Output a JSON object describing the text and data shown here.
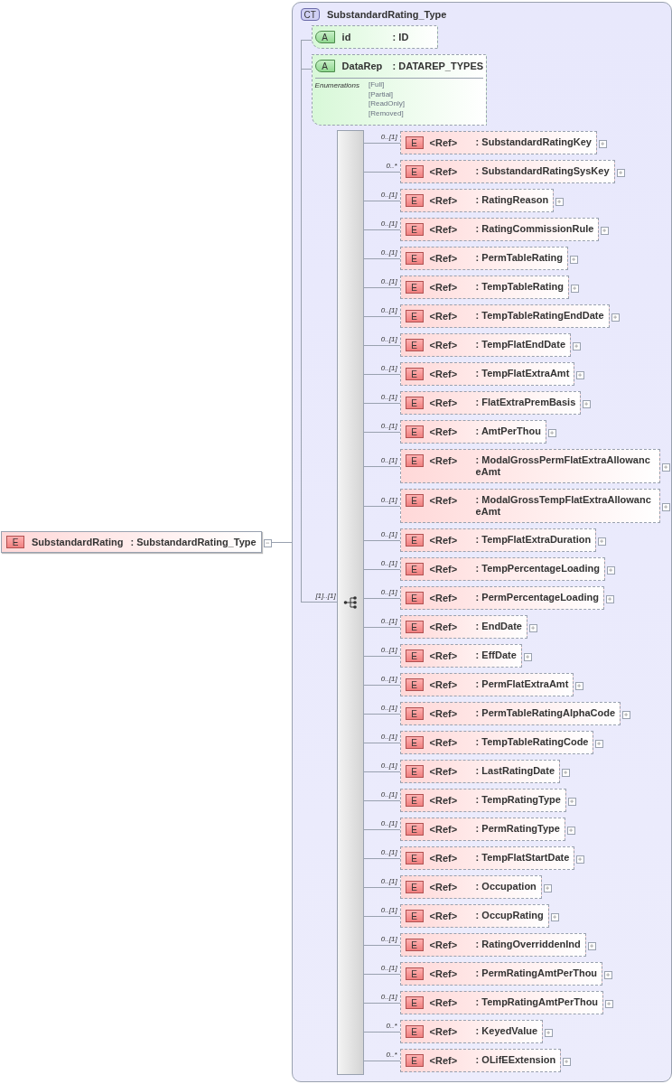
{
  "root_element": {
    "badge": "E",
    "name": "SubstandardRating",
    "type": ": SubstandardRating_Type",
    "expanded": true
  },
  "complex_type": {
    "badge": "CT",
    "name": "SubstandardRating_Type",
    "attributes": [
      {
        "badge": "A",
        "name": "id",
        "type": ": ID"
      },
      {
        "badge": "A",
        "name": "DataRep",
        "type": ": DATAREP_TYPES",
        "enumerations_label": "Enumerations",
        "enumerations": [
          "[Full]",
          "[Partial]",
          "[ReadOnly]",
          "[Removed]"
        ]
      }
    ],
    "sequence": {
      "multiplicity": "[1]..[1]",
      "elements": [
        {
          "multiplicity": "0..[1]",
          "badge": "E",
          "ref": "<Ref>",
          "name": ": SubstandardRatingKey",
          "expanded": false
        },
        {
          "multiplicity": "0..*",
          "badge": "E",
          "ref": "<Ref>",
          "name": ": SubstandardRatingSysKey",
          "expanded": false
        },
        {
          "multiplicity": "0..[1]",
          "badge": "E",
          "ref": "<Ref>",
          "name": ": RatingReason",
          "expanded": false
        },
        {
          "multiplicity": "0..[1]",
          "badge": "E",
          "ref": "<Ref>",
          "name": ": RatingCommissionRule",
          "expanded": false
        },
        {
          "multiplicity": "0..[1]",
          "badge": "E",
          "ref": "<Ref>",
          "name": ": PermTableRating",
          "expanded": false
        },
        {
          "multiplicity": "0..[1]",
          "badge": "E",
          "ref": "<Ref>",
          "name": ": TempTableRating",
          "expanded": false
        },
        {
          "multiplicity": "0..[1]",
          "badge": "E",
          "ref": "<Ref>",
          "name": ": TempTableRatingEndDate",
          "expanded": false
        },
        {
          "multiplicity": "0..[1]",
          "badge": "E",
          "ref": "<Ref>",
          "name": ": TempFlatEndDate",
          "expanded": false
        },
        {
          "multiplicity": "0..[1]",
          "badge": "E",
          "ref": "<Ref>",
          "name": ": TempFlatExtraAmt",
          "expanded": false
        },
        {
          "multiplicity": "0..[1]",
          "badge": "E",
          "ref": "<Ref>",
          "name": ": FlatExtraPremBasis",
          "expanded": false
        },
        {
          "multiplicity": "0..[1]",
          "badge": "E",
          "ref": "<Ref>",
          "name": ": AmtPerThou",
          "expanded": false
        },
        {
          "multiplicity": "0..[1]",
          "badge": "E",
          "ref": "<Ref>",
          "name": ": ModalGrossPermFlatExtraAllowanceAmt",
          "expanded": false
        },
        {
          "multiplicity": "0..[1]",
          "badge": "E",
          "ref": "<Ref>",
          "name": ": ModalGrossTempFlatExtraAllowanceAmt",
          "expanded": false
        },
        {
          "multiplicity": "0..[1]",
          "badge": "E",
          "ref": "<Ref>",
          "name": ": TempFlatExtraDuration",
          "expanded": false
        },
        {
          "multiplicity": "0..[1]",
          "badge": "E",
          "ref": "<Ref>",
          "name": ": TempPercentageLoading",
          "expanded": false
        },
        {
          "multiplicity": "0..[1]",
          "badge": "E",
          "ref": "<Ref>",
          "name": ": PermPercentageLoading",
          "expanded": false
        },
        {
          "multiplicity": "0..[1]",
          "badge": "E",
          "ref": "<Ref>",
          "name": ": EndDate",
          "expanded": false
        },
        {
          "multiplicity": "0..[1]",
          "badge": "E",
          "ref": "<Ref>",
          "name": ": EffDate",
          "expanded": false
        },
        {
          "multiplicity": "0..[1]",
          "badge": "E",
          "ref": "<Ref>",
          "name": ": PermFlatExtraAmt",
          "expanded": false
        },
        {
          "multiplicity": "0..[1]",
          "badge": "E",
          "ref": "<Ref>",
          "name": ": PermTableRatingAlphaCode",
          "expanded": false
        },
        {
          "multiplicity": "0..[1]",
          "badge": "E",
          "ref": "<Ref>",
          "name": ": TempTableRatingCode",
          "expanded": false
        },
        {
          "multiplicity": "0..[1]",
          "badge": "E",
          "ref": "<Ref>",
          "name": ": LastRatingDate",
          "expanded": false
        },
        {
          "multiplicity": "0..[1]",
          "badge": "E",
          "ref": "<Ref>",
          "name": ": TempRatingType",
          "expanded": false
        },
        {
          "multiplicity": "0..[1]",
          "badge": "E",
          "ref": "<Ref>",
          "name": ": PermRatingType",
          "expanded": false
        },
        {
          "multiplicity": "0..[1]",
          "badge": "E",
          "ref": "<Ref>",
          "name": ": TempFlatStartDate",
          "expanded": false
        },
        {
          "multiplicity": "0..[1]",
          "badge": "E",
          "ref": "<Ref>",
          "name": ": Occupation",
          "expanded": false
        },
        {
          "multiplicity": "0..[1]",
          "badge": "E",
          "ref": "<Ref>",
          "name": ": OccupRating",
          "expanded": false
        },
        {
          "multiplicity": "0..[1]",
          "badge": "E",
          "ref": "<Ref>",
          "name": ": RatingOverriddenInd",
          "expanded": false
        },
        {
          "multiplicity": "0..[1]",
          "badge": "E",
          "ref": "<Ref>",
          "name": ": PermRatingAmtPerThou",
          "expanded": false
        },
        {
          "multiplicity": "0..[1]",
          "badge": "E",
          "ref": "<Ref>",
          "name": ": TempRatingAmtPerThou",
          "expanded": false
        },
        {
          "multiplicity": "0..*",
          "badge": "E",
          "ref": "<Ref>",
          "name": ": KeyedValue",
          "expanded": false
        },
        {
          "multiplicity": "0..*",
          "badge": "E",
          "ref": "<Ref>",
          "name": ": OLifEExtension",
          "expanded": false
        }
      ]
    }
  }
}
